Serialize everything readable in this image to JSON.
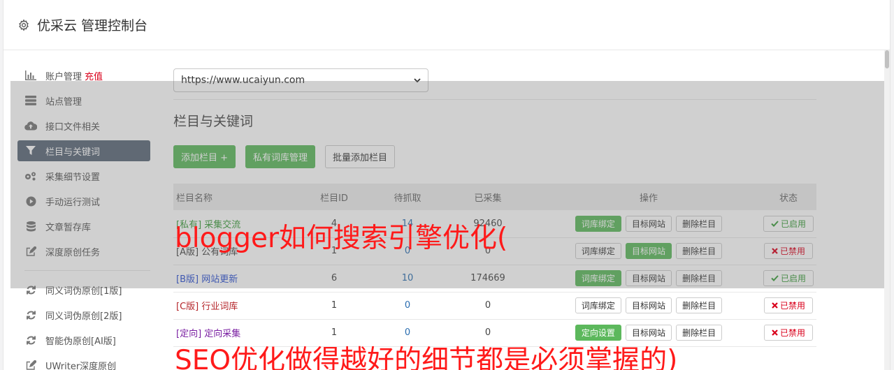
{
  "header": {
    "title": "优采云 管理控制台"
  },
  "sidebar": {
    "items": [
      {
        "label": "账户管理",
        "badge": "充值",
        "icon": "bar-chart-icon"
      },
      {
        "label": "站点管理",
        "icon": "server-icon"
      },
      {
        "label": "接口文件相关",
        "icon": "cloud-upload-icon"
      },
      {
        "label": "栏目与关键词",
        "icon": "filter-icon",
        "active": true
      },
      {
        "label": "采集细节设置",
        "icon": "gears-icon"
      },
      {
        "label": "手动运行测试",
        "icon": "play-circle-icon"
      },
      {
        "label": "文章暂存库",
        "icon": "database-icon"
      },
      {
        "label": "深度原创任务",
        "icon": "edit-icon"
      }
    ],
    "tools": [
      {
        "label": "同义词伪原创[1版]",
        "icon": "refresh-icon"
      },
      {
        "label": "同义词伪原创[2版]",
        "icon": "refresh-icon"
      },
      {
        "label": "智能伪原创[AI版]",
        "icon": "refresh-icon"
      },
      {
        "label": "UWriter深度原创",
        "icon": "edit-icon"
      }
    ]
  },
  "main": {
    "site_select": "https://www.ucaiyun.com",
    "section_title": "栏目与关键词",
    "buttons": {
      "add": "添加栏目 +",
      "private_lib": "私有词库管理",
      "batch_add": "批量添加栏目"
    },
    "table": {
      "headers": [
        "栏目名称",
        "栏目ID",
        "待抓取",
        "已采集",
        "操作",
        "状态"
      ],
      "rows": [
        {
          "tag": "[私有]",
          "name": "采集交流",
          "id": "4",
          "pending": "14",
          "collected": "92460",
          "bind": "词库绑定",
          "target": "目标网站",
          "delete": "删除栏目",
          "status": "已启用",
          "color": "green",
          "bind_green": true,
          "target_green": false,
          "enabled": true
        },
        {
          "tag": "[A版]",
          "name": "公有词库",
          "id": "1",
          "pending": "0",
          "collected": "0",
          "bind": "词库绑定",
          "target": "目标网站",
          "delete": "删除栏目",
          "status": "已禁用",
          "color": "dark",
          "bind_green": false,
          "target_green": true,
          "enabled": false
        },
        {
          "tag": "[B版]",
          "name": "网站更新",
          "id": "6",
          "pending": "10",
          "collected": "174669",
          "bind": "词库绑定",
          "target": "目标网站",
          "delete": "删除栏目",
          "status": "已启用",
          "color": "blue",
          "bind_green": true,
          "target_green": false,
          "enabled": true
        },
        {
          "tag": "[C版]",
          "name": "行业词库",
          "id": "1",
          "pending": "0",
          "collected": "0",
          "bind": "词库绑定",
          "target": "目标网站",
          "delete": "删除栏目",
          "status": "已禁用",
          "color": "red",
          "bind_green": false,
          "target_green": false,
          "enabled": false
        },
        {
          "tag": "[定向]",
          "name": "定向采集",
          "id": "1",
          "pending": "0",
          "collected": "0",
          "bind": "定向设置",
          "target": "目标网站",
          "delete": "删除栏目",
          "status": "已禁用",
          "color": "purple",
          "bind_green": true,
          "target_green": false,
          "enabled": false
        }
      ]
    }
  },
  "watermarks": {
    "line1": "blogger如何搜索引擎优化(",
    "line2": "SEO优化做得越好的细节都是必须掌握的)"
  },
  "colors": {
    "primary_green": "#5cb85c",
    "active_nav": "#5a6878",
    "danger": "#d9001b"
  }
}
